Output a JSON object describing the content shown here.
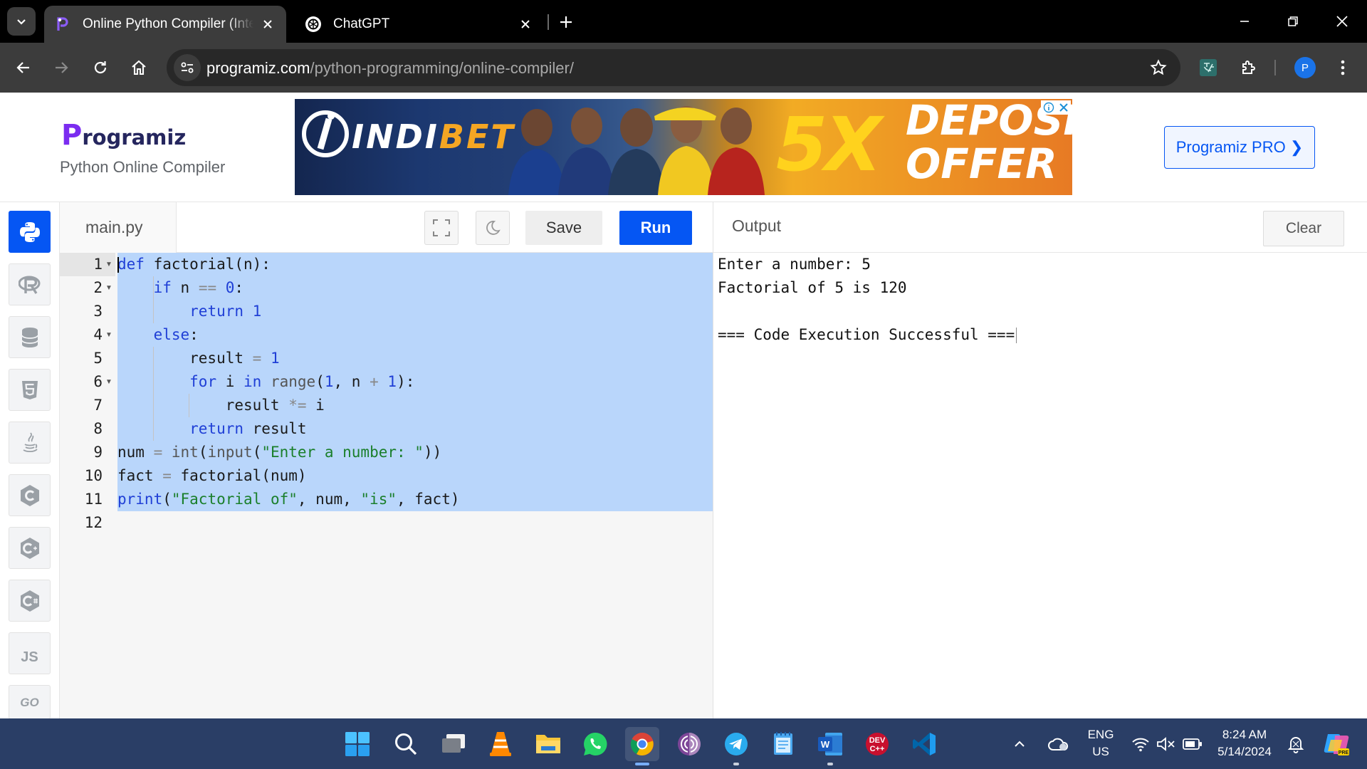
{
  "browser": {
    "tabs": [
      {
        "title": "Online Python Compiler (Interpreter)",
        "favicon": "programiz-favicon",
        "active": true
      },
      {
        "title": "ChatGPT",
        "favicon": "chatgpt-favicon",
        "active": false
      }
    ],
    "url_domain": "programiz.com",
    "url_path": "/python-programming/online-compiler/",
    "profile_initial": "P"
  },
  "site": {
    "logo_text": "rogramiz",
    "logo_letter": "P",
    "subtitle": "Python Online Compiler",
    "pro_button": "Programiz PRO ❯"
  },
  "ad": {
    "brand_a": "INDI",
    "brand_b": "BET",
    "headline": "5X",
    "line1": "DEPOSIT",
    "line2": "OFFER"
  },
  "sidebar": {
    "languages": [
      "python",
      "r",
      "sql",
      "html",
      "java",
      "c",
      "cpp",
      "csharp",
      "javascript",
      "go"
    ],
    "js_label": "JS",
    "go_label": "GO"
  },
  "editor": {
    "filename": "main.py",
    "save_label": "Save",
    "run_label": "Run",
    "lines": [
      "def factorial(n):",
      "    if n == 0:",
      "        return 1",
      "    else:",
      "        result = 1",
      "        for i in range(1, n + 1):",
      "            result *= i",
      "        return result",
      "num = int(input(\"Enter a number: \"))",
      "fact = factorial(num)",
      "print(\"Factorial of\", num, \"is\", fact)",
      ""
    ],
    "line_numbers": [
      "1",
      "2",
      "3",
      "4",
      "5",
      "6",
      "7",
      "8",
      "9",
      "10",
      "11",
      "12"
    ]
  },
  "output": {
    "title": "Output",
    "clear_label": "Clear",
    "lines": [
      "Enter a number: 5",
      "Factorial of 5 is 120",
      "",
      "=== Code Execution Successful ==="
    ]
  },
  "taskbar": {
    "apps": [
      "start",
      "search",
      "task-view",
      "vlc",
      "file-explorer",
      "whatsapp",
      "chrome",
      "tor-browser",
      "telegram",
      "notepad",
      "word",
      "dev-cpp",
      "vscode"
    ],
    "lang_line1": "ENG",
    "lang_line2": "US",
    "time": "8:24 AM",
    "date": "5/14/2024"
  },
  "colors": {
    "accent": "#0556f3",
    "brand_purple": "#7b2cf0",
    "selection": "#b9d6fb",
    "keyword": "#1f3fd6",
    "string": "#1a7f2b",
    "number": "#1f3fd6"
  }
}
